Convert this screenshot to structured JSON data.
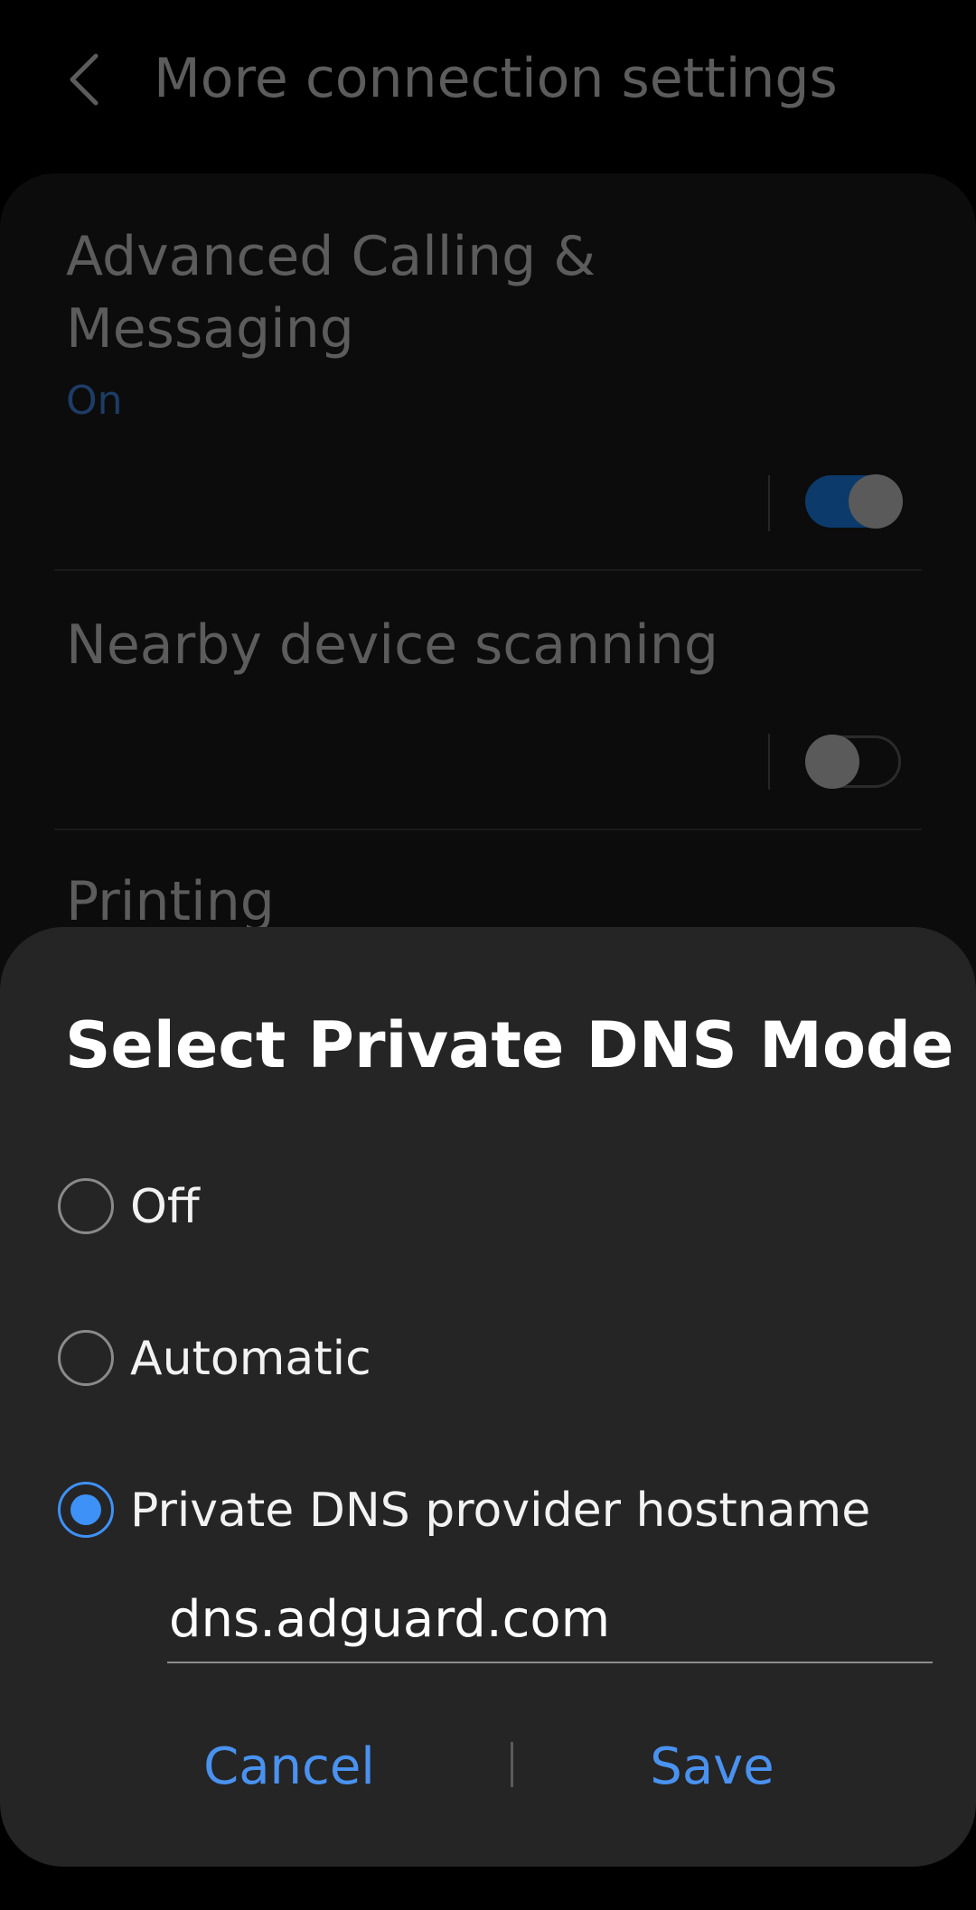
{
  "header": {
    "back_icon": "chevron-left-icon",
    "title": "More connection settings"
  },
  "settings": {
    "advanced_calling": {
      "title_line1": "Advanced Calling &",
      "title_line2": "Messaging",
      "status": "On",
      "toggle_on": true
    },
    "nearby_scanning": {
      "title": "Nearby device scanning",
      "toggle_on": false
    },
    "printing": {
      "title": "Printing"
    }
  },
  "dialog": {
    "title": "Select Private DNS Mode",
    "options": [
      {
        "label": "Off",
        "selected": false
      },
      {
        "label": "Automatic",
        "selected": false
      },
      {
        "label": "Private DNS provider hostname",
        "selected": true
      }
    ],
    "hostname_value": "dns.adguard.com",
    "cancel_label": "Cancel",
    "save_label": "Save"
  },
  "colors": {
    "accent": "#3e91f7",
    "dialog_bg": "#252525",
    "screen_bg": "#000000"
  }
}
